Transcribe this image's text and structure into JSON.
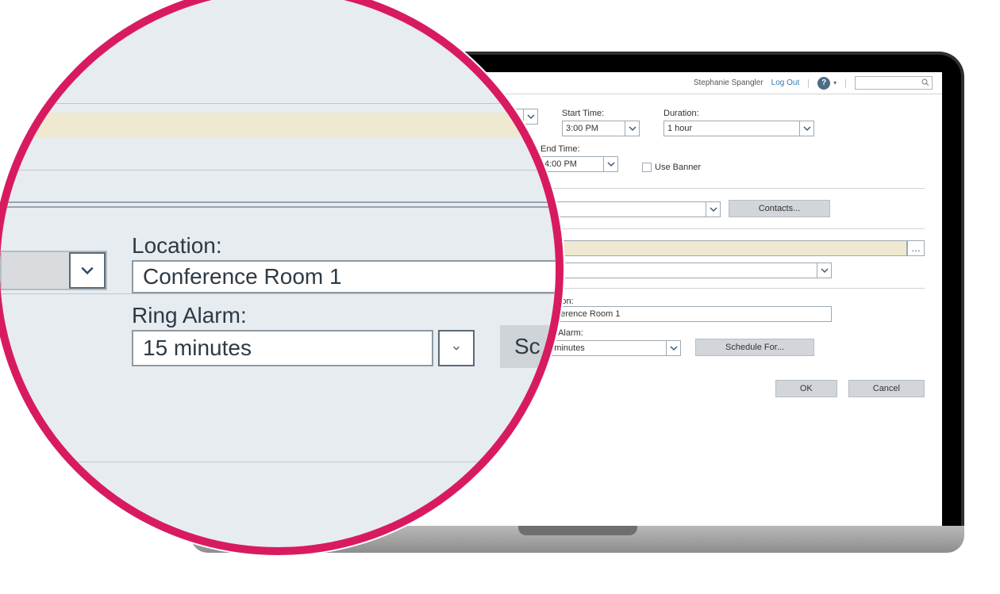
{
  "header": {
    "user": "Stephanie Spangler",
    "logout": "Log Out"
  },
  "dialog": {
    "start_time_label": "Start Time:",
    "start_time_value": "3:00 PM",
    "end_time_label": "End Time:",
    "end_time_value": "4:00 PM",
    "duration_label": "Duration:",
    "duration_value": "1 hour",
    "use_banner_label": "Use Banner",
    "contacts_button": "Contacts...",
    "location_label": "Location:",
    "location_value": "Conference Room 1",
    "ring_alarm_label": "Ring Alarm:",
    "ring_alarm_value": "15 minutes",
    "schedule_for_button": "Schedule For...",
    "ok_button": "OK",
    "cancel_button": "Cancel"
  },
  "zoom": {
    "location_label": "Location:",
    "location_value": "Conference Room 1",
    "ring_alarm_label": "Ring Alarm:",
    "ring_alarm_value": "15 minutes",
    "schedule_for_partial": "Sc"
  }
}
